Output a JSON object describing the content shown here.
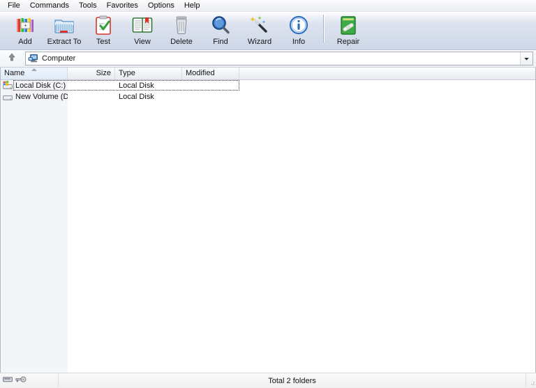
{
  "menubar": {
    "items": [
      {
        "label": "File",
        "name": "menu-file"
      },
      {
        "label": "Commands",
        "name": "menu-commands"
      },
      {
        "label": "Tools",
        "name": "menu-tools"
      },
      {
        "label": "Favorites",
        "name": "menu-favorites"
      },
      {
        "label": "Options",
        "name": "menu-options"
      },
      {
        "label": "Help",
        "name": "menu-help"
      }
    ]
  },
  "toolbar": {
    "buttons": [
      {
        "label": "Add",
        "icon": "add-archive-icon"
      },
      {
        "label": "Extract To",
        "icon": "extract-folder-icon"
      },
      {
        "label": "Test",
        "icon": "test-clipboard-icon"
      },
      {
        "label": "View",
        "icon": "view-book-icon"
      },
      {
        "label": "Delete",
        "icon": "delete-trash-icon"
      },
      {
        "label": "Find",
        "icon": "find-magnifier-icon"
      },
      {
        "label": "Wizard",
        "icon": "wizard-wand-icon"
      },
      {
        "label": "Info",
        "icon": "info-circle-icon"
      },
      {
        "label": "Repair",
        "icon": "repair-archive-icon"
      }
    ]
  },
  "addressbar": {
    "up_button_icon": "up-arrow-icon",
    "location_icon": "computer-icon",
    "location_value": "Computer",
    "dropdown_icon": "chevron-down-icon"
  },
  "filelist": {
    "columns": [
      {
        "label": "Name",
        "key": "name"
      },
      {
        "label": "Size",
        "key": "size"
      },
      {
        "label": "Type",
        "key": "type"
      },
      {
        "label": "Modified",
        "key": "modified"
      }
    ],
    "sorted_column": "Name",
    "rows": [
      {
        "name": "Local Disk (C:)",
        "size": "",
        "type": "Local Disk",
        "modified": "",
        "icon": "system-drive-icon",
        "selected": true
      },
      {
        "name": "New Volume (D:)",
        "size": "",
        "type": "Local Disk",
        "modified": "",
        "icon": "drive-icon",
        "selected": false
      }
    ]
  },
  "statusbar": {
    "disk_icon": "disk-icon",
    "key_icon": "key-icon",
    "total_text": "Total 2 folders"
  },
  "colors": {
    "toolbar_top": "#ffffff",
    "toolbar_bottom": "#cdd6e7",
    "menubar_bg": "#f3f4f7",
    "list_bg": "#ffffff",
    "name_column_tint": "#f4f5f8",
    "text": "#101114",
    "border": "#b4b9c4",
    "sorted_header": "#dfeaf8"
  }
}
